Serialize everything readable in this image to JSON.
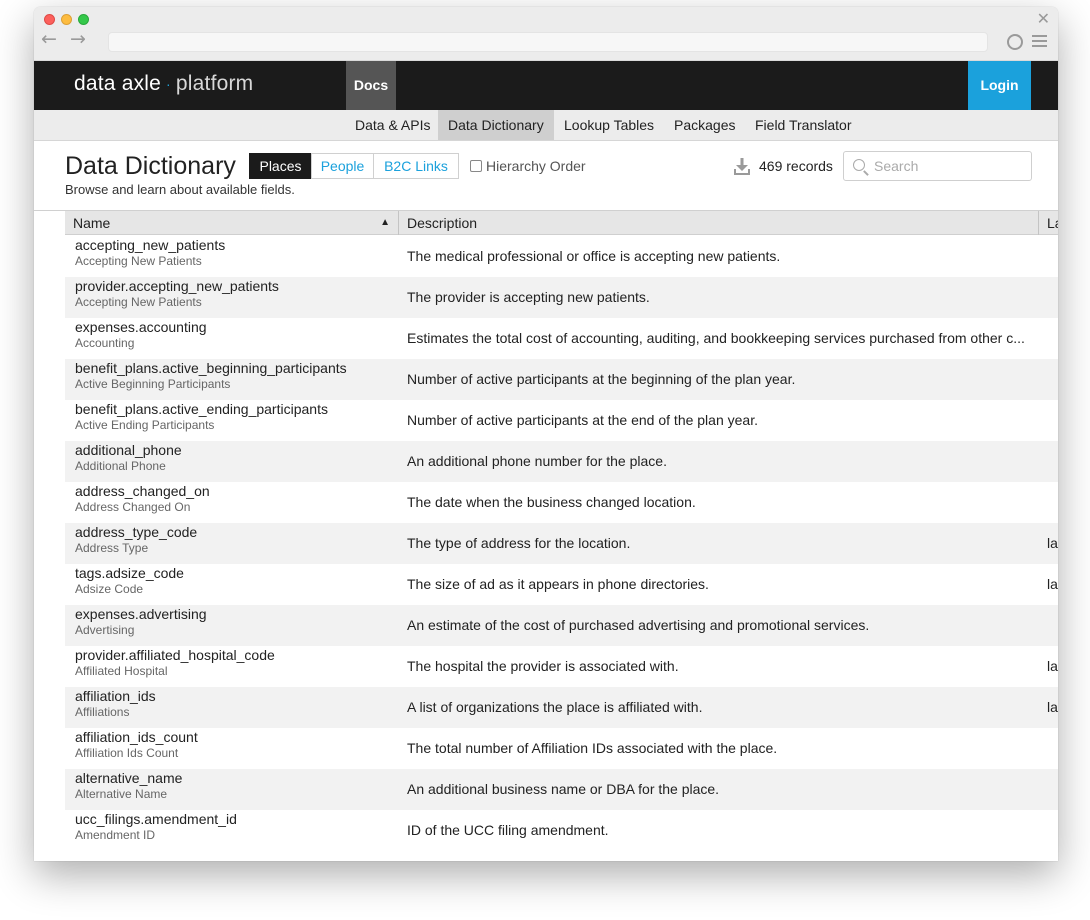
{
  "site": {
    "logo_main": "data axle",
    "logo_sep": "·",
    "logo_sub": "platform",
    "docs_tab": "Docs",
    "login": "Login"
  },
  "subnav": {
    "items": [
      {
        "label": "Data & APIs"
      },
      {
        "label": "Data Dictionary"
      },
      {
        "label": "Lookup Tables"
      },
      {
        "label": "Packages"
      },
      {
        "label": "Field Translator"
      }
    ],
    "active": "Data Dictionary"
  },
  "page": {
    "title": "Data Dictionary",
    "subtitle": "Browse and learn about available fields.",
    "segments": [
      {
        "label": "Places"
      },
      {
        "label": "People"
      },
      {
        "label": "B2C Links"
      }
    ],
    "active_segment": "Places",
    "hierarchy_label": "Hierarchy Order",
    "hierarchy_checked": false,
    "records": "469 records",
    "search_placeholder": "Search"
  },
  "table": {
    "columns": [
      {
        "label": "Name",
        "sort": "ascending"
      },
      {
        "label": "Description"
      },
      {
        "label": "La"
      }
    ],
    "rows": [
      {
        "name": "accepting_new_patients",
        "label": "Accepting New Patients",
        "description": "The medical professional or office is accepting new patients.",
        "extra": ""
      },
      {
        "name": "provider.accepting_new_patients",
        "label": "Accepting New Patients",
        "description": "The provider is accepting new patients.",
        "extra": ""
      },
      {
        "name": "expenses.accounting",
        "label": "Accounting",
        "description": "Estimates the total cost of accounting, auditing, and bookkeeping services purchased from other c...",
        "extra": ""
      },
      {
        "name": "benefit_plans.active_beginning_participants",
        "label": "Active Beginning Participants",
        "description": "Number of active participants at the beginning of the plan year.",
        "extra": ""
      },
      {
        "name": "benefit_plans.active_ending_participants",
        "label": "Active Ending Participants",
        "description": "Number of active participants at the end of the plan year.",
        "extra": ""
      },
      {
        "name": "additional_phone",
        "label": "Additional Phone",
        "description": "An additional phone number for the place.",
        "extra": ""
      },
      {
        "name": "address_changed_on",
        "label": "Address Changed On",
        "description": "The date when the business changed location.",
        "extra": ""
      },
      {
        "name": "address_type_code",
        "label": "Address Type",
        "description": "The type of address for the location.",
        "extra": "la"
      },
      {
        "name": "tags.adsize_code",
        "label": "Adsize Code",
        "description": "The size of ad as it appears in phone directories.",
        "extra": "la"
      },
      {
        "name": "expenses.advertising",
        "label": "Advertising",
        "description": "An estimate of the cost of purchased advertising and promotional services.",
        "extra": ""
      },
      {
        "name": "provider.affiliated_hospital_code",
        "label": "Affiliated Hospital",
        "description": "The hospital the provider is associated with.",
        "extra": "la"
      },
      {
        "name": "affiliation_ids",
        "label": "Affiliations",
        "description": "A list of organizations the place is affiliated with.",
        "extra": "la"
      },
      {
        "name": "affiliation_ids_count",
        "label": "Affiliation Ids Count",
        "description": "The total number of Affiliation IDs associated with the place.",
        "extra": ""
      },
      {
        "name": "alternative_name",
        "label": "Alternative Name",
        "description": "An additional business name or DBA for the place.",
        "extra": ""
      },
      {
        "name": "ucc_filings.amendment_id",
        "label": "Amendment ID",
        "description": "ID of the UCC filing amendment.",
        "extra": ""
      }
    ]
  }
}
